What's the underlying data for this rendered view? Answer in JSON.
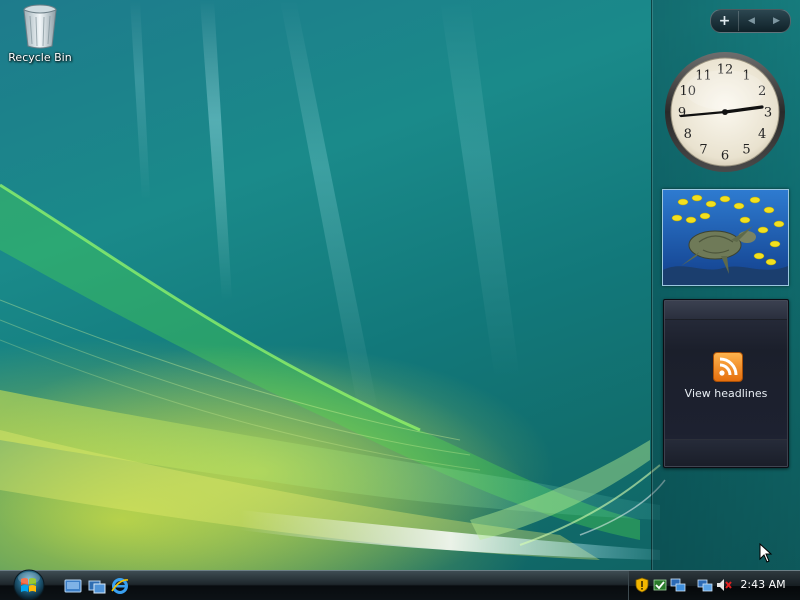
{
  "desktop": {
    "icons": [
      {
        "label": "Recycle Bin",
        "icon": "recycle-bin-icon"
      }
    ]
  },
  "sidebar": {
    "controls": {
      "add": "+",
      "prev": "◀",
      "next": "▶"
    },
    "clock_gadget": {
      "numerals": [
        "12",
        "1",
        "2",
        "3",
        "4",
        "5",
        "6",
        "7",
        "8",
        "9",
        "10",
        "11"
      ],
      "time": "2:43"
    },
    "slideshow_gadget": {
      "image": "sea-turtle-with-fish",
      "colors": {
        "water": "#1f63b8",
        "fish": "#f2e020"
      }
    },
    "feed_gadget": {
      "icon": "rss-feed-icon",
      "label": "View headlines"
    }
  },
  "taskbar": {
    "start_button": "windows-start-orb-icon",
    "quick_launch": [
      "show-desktop-icon",
      "switch-windows-icon",
      "internet-explorer-icon"
    ],
    "tray": {
      "icons": [
        "security-shield-icon",
        "defender-icon",
        "network-icon",
        "network-connection-icon",
        "volume-muted-icon"
      ],
      "clock": "2:43 AM"
    }
  },
  "colors": {
    "wallpaper_teal": "#137a7c",
    "wallpaper_green": "#c8e04a",
    "taskbar": "#10171b",
    "accent_rss": "#f07b14"
  }
}
